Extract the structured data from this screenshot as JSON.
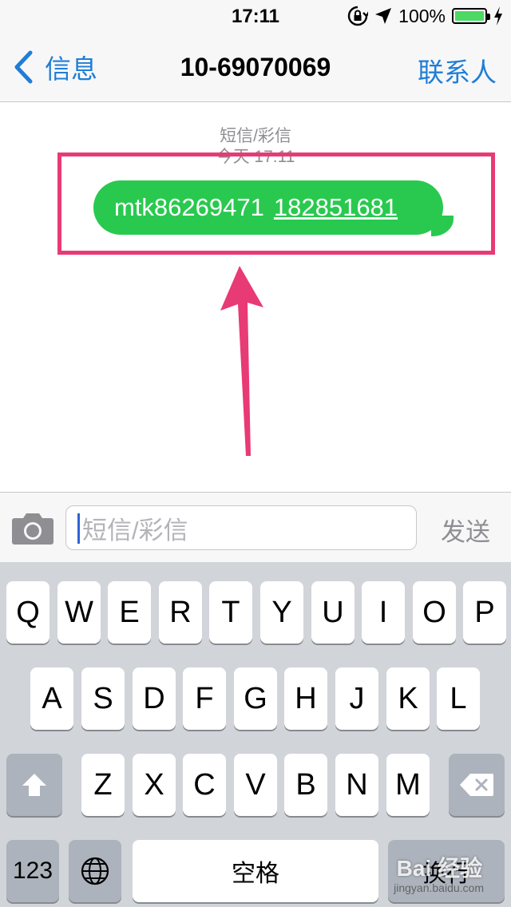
{
  "status_bar": {
    "time": "17:11",
    "battery_percent": "100%"
  },
  "nav": {
    "back_label": "信息",
    "title": "10-69070069",
    "contacts_label": "联系人"
  },
  "conversation": {
    "message_type": "短信/彩信",
    "timestamp": "今天 17:11",
    "message_text": "mtk86269471",
    "message_link": "182851681"
  },
  "annotation": {
    "highlight_color": "#e83a75"
  },
  "compose": {
    "placeholder": "短信/彩信",
    "send_label": "发送"
  },
  "keyboard": {
    "row1": [
      "Q",
      "W",
      "E",
      "R",
      "T",
      "Y",
      "U",
      "I",
      "O",
      "P"
    ],
    "row2": [
      "A",
      "S",
      "D",
      "F",
      "G",
      "H",
      "J",
      "K",
      "L"
    ],
    "row3": [
      "Z",
      "X",
      "C",
      "V",
      "B",
      "N",
      "M"
    ],
    "numbers_label": "123",
    "space_label": "空格",
    "return_label": "换行"
  },
  "watermark": {
    "text": "Bai 经验",
    "sub": "jingyan.baidu.com"
  },
  "colors": {
    "accent": "#1f7ed6",
    "bubble": "#29c94f",
    "battery": "#4cd964"
  }
}
